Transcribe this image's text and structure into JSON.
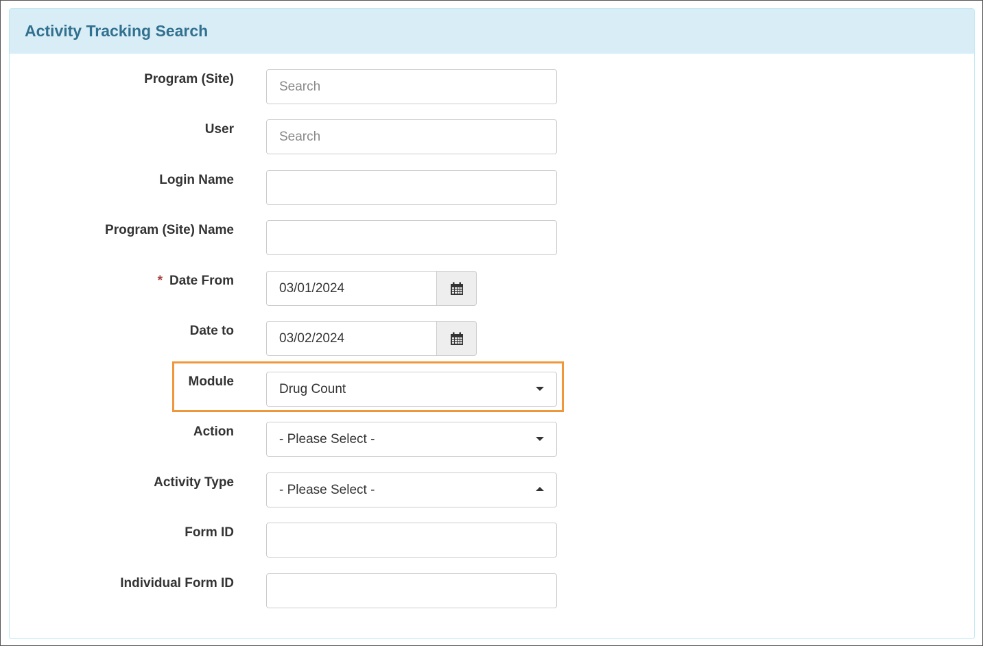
{
  "panel": {
    "title": "Activity Tracking Search"
  },
  "fields": {
    "program_site": {
      "label": "Program (Site)",
      "placeholder": "Search",
      "value": ""
    },
    "user": {
      "label": "User",
      "placeholder": "Search",
      "value": ""
    },
    "login_name": {
      "label": "Login Name",
      "value": ""
    },
    "program_site_name": {
      "label": "Program (Site) Name",
      "value": ""
    },
    "date_from": {
      "label": "Date From",
      "required_mark": "*",
      "value": "03/01/2024",
      "icon": "calendar-icon"
    },
    "date_to": {
      "label": "Date to",
      "value": "03/02/2024",
      "icon": "calendar-icon"
    },
    "module": {
      "label": "Module",
      "value": "Drug Count",
      "caret": "down",
      "highlighted": true
    },
    "action": {
      "label": "Action",
      "value": "- Please Select -",
      "caret": "down"
    },
    "activity_type": {
      "label": "Activity Type",
      "value": "- Please Select -",
      "caret": "up"
    },
    "form_id": {
      "label": "Form ID",
      "value": ""
    },
    "individual_form_id": {
      "label": "Individual Form ID",
      "value": ""
    }
  },
  "colors": {
    "heading_bg": "#d9edf7",
    "heading_text": "#31708f",
    "highlight_border": "#f0963c",
    "required": "#a94442"
  }
}
